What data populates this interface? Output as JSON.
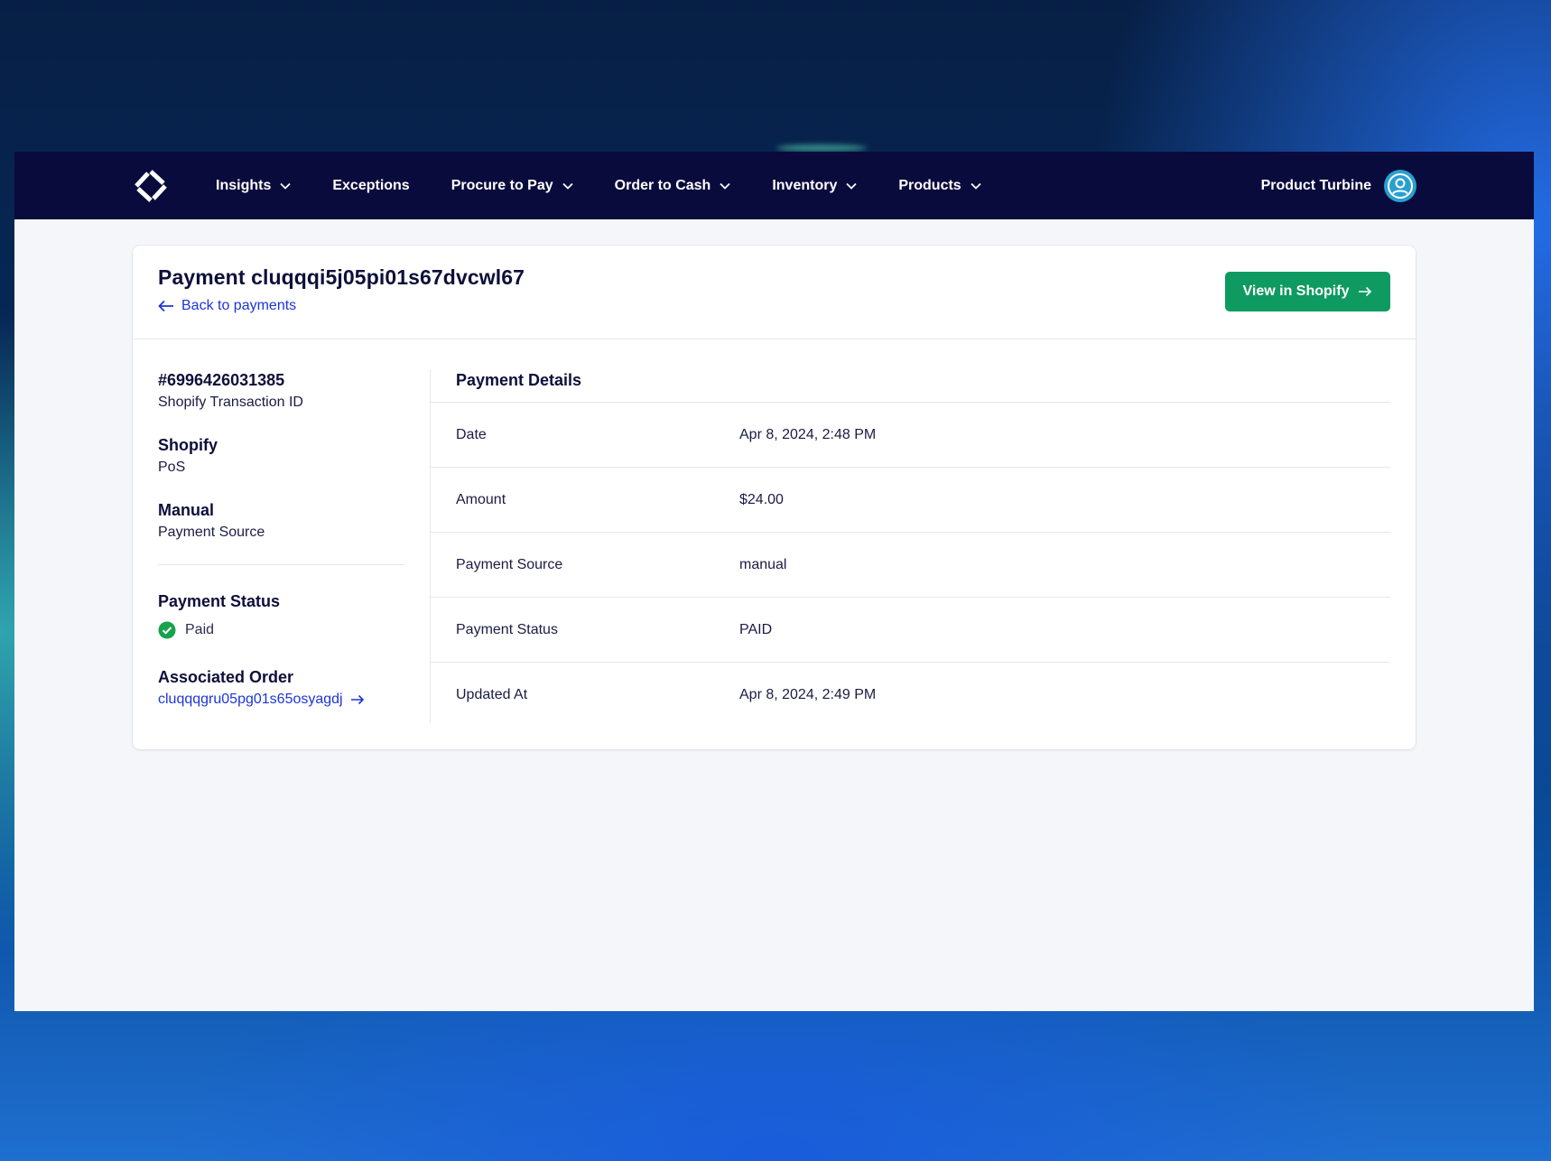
{
  "nav": {
    "logo_icon": "turbine-logo-icon",
    "items": [
      {
        "label": "Insights",
        "has_dropdown": true
      },
      {
        "label": "Exceptions",
        "has_dropdown": false
      },
      {
        "label": "Procure to Pay",
        "has_dropdown": true
      },
      {
        "label": "Order to Cash",
        "has_dropdown": true
      },
      {
        "label": "Inventory",
        "has_dropdown": true
      },
      {
        "label": "Products",
        "has_dropdown": true
      }
    ],
    "user_name": "Product Turbine",
    "user_icon": "user-avatar-icon"
  },
  "header": {
    "title": "Payment cluqqqi5j05pi01s67dvcwl67",
    "back_label": "Back to payments",
    "view_button_label": "View in Shopify"
  },
  "summary": {
    "transaction_id": "#6996426031385",
    "transaction_id_label": "Shopify Transaction ID",
    "channel": "Shopify",
    "channel_sub": "PoS",
    "source": "Manual",
    "source_label": "Payment Source",
    "status_heading": "Payment Status",
    "status_value": "Paid",
    "order_heading": "Associated Order",
    "order_link": "cluqqqgru05pg01s65osyagdj"
  },
  "details": {
    "heading": "Payment Details",
    "rows": [
      {
        "label": "Date",
        "value": "Apr 8, 2024, 2:48 PM"
      },
      {
        "label": "Amount",
        "value": "$24.00"
      },
      {
        "label": "Payment Source",
        "value": "manual"
      },
      {
        "label": "Payment Status",
        "value": "PAID"
      },
      {
        "label": "Updated At",
        "value": "Apr 8, 2024, 2:49 PM"
      }
    ]
  },
  "colors": {
    "nav_bg": "#0a0b3d",
    "accent_link": "#1d35d8",
    "button_green": "#0e9a61",
    "status_green": "#16a34a"
  }
}
